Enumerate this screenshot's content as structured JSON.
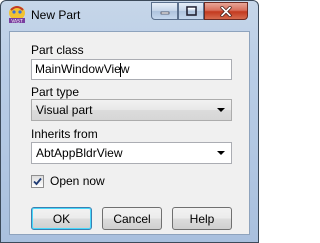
{
  "window": {
    "title": "New Part",
    "icon": "vast-app-icon",
    "controls": {
      "minimize": "minimize-icon",
      "maximize": "maximize-icon",
      "close": "close-icon"
    }
  },
  "form": {
    "part_class": {
      "label": "Part class",
      "value": "MainWindowView"
    },
    "part_type": {
      "label": "Part type",
      "selected": "Visual part"
    },
    "inherits_from": {
      "label": "Inherits from",
      "value": "AbtAppBldrView"
    },
    "open_now": {
      "label": "Open now",
      "checked": true
    }
  },
  "buttons": {
    "ok": "OK",
    "cancel": "Cancel",
    "help": "Help"
  },
  "colors": {
    "title_gradient_top": "#c6d6e9",
    "close_button": "#c33a1f",
    "dialog_bg": "#f0f0f0",
    "default_button_glow": "#48d8fb"
  }
}
